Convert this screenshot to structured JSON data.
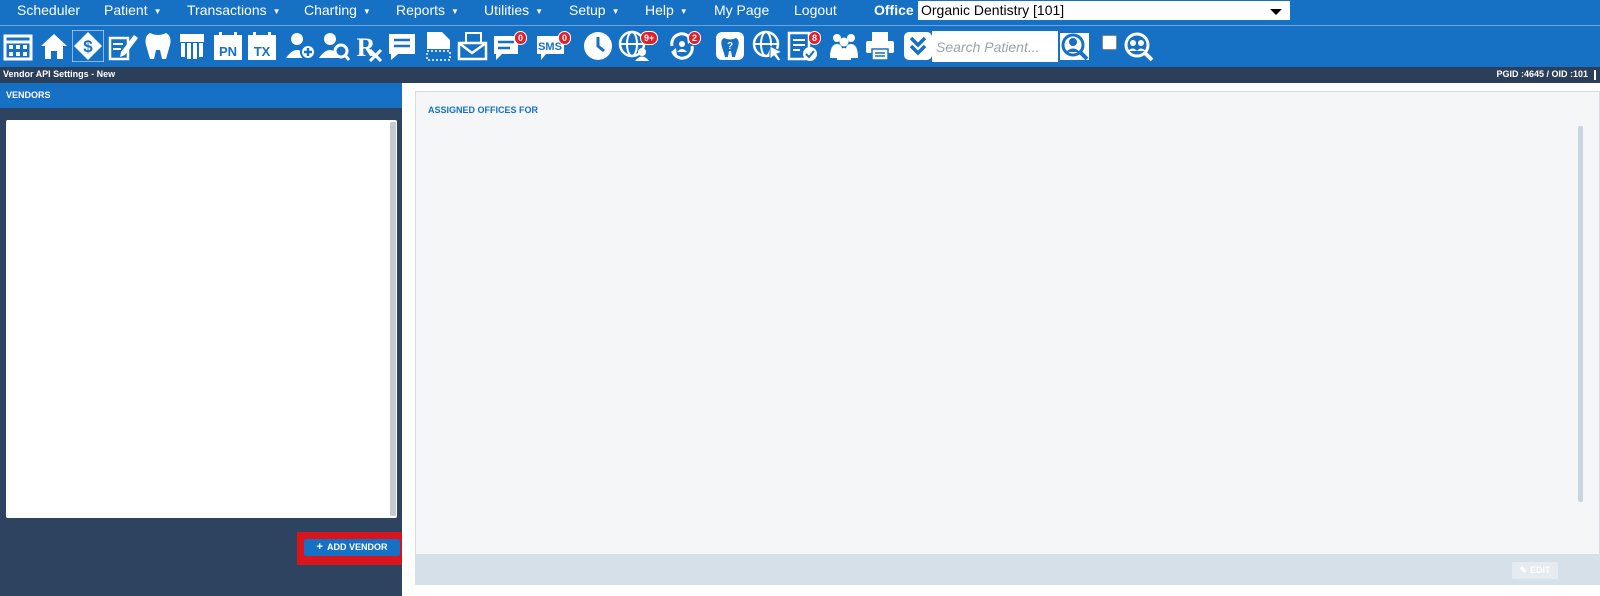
{
  "menu": {
    "items": [
      {
        "label": "Scheduler",
        "caret": false
      },
      {
        "label": "Patient",
        "caret": true
      },
      {
        "label": "Transactions",
        "caret": true
      },
      {
        "label": "Charting",
        "caret": true
      },
      {
        "label": "Reports",
        "caret": true
      },
      {
        "label": "Utilities",
        "caret": true
      },
      {
        "label": "Setup",
        "caret": true
      },
      {
        "label": "Help",
        "caret": true
      },
      {
        "label": "My Page",
        "caret": false
      },
      {
        "label": "Logout",
        "caret": false
      }
    ],
    "office_label": "Office",
    "office_value": "Organic Dentistry [101]"
  },
  "toolbar": {
    "icons": [
      {
        "name": "calendar-icon"
      },
      {
        "name": "home-icon"
      },
      {
        "name": "dollar-icon"
      },
      {
        "name": "edit-icon"
      },
      {
        "name": "tooth-icon"
      },
      {
        "name": "teeth-chart-icon"
      },
      {
        "name": "pn-calendar-icon",
        "text": "PN"
      },
      {
        "name": "tx-calendar-icon",
        "text": "TX"
      },
      {
        "name": "add-patient-icon"
      },
      {
        "name": "search-patient-icon"
      },
      {
        "name": "rx-icon",
        "text": "Rx"
      },
      {
        "name": "notes-icon"
      },
      {
        "name": "document-icon"
      },
      {
        "name": "mail-icon"
      },
      {
        "name": "chat-icon",
        "badge": "0"
      },
      {
        "name": "sms-icon",
        "text": "SMS",
        "badge": "0"
      },
      {
        "name": "clock-icon"
      },
      {
        "name": "globe-users-icon",
        "badge": "9+"
      },
      {
        "name": "sync-icon",
        "badge": "2"
      },
      {
        "name": "help-tooth-icon"
      },
      {
        "name": "web-cursor-icon"
      },
      {
        "name": "checklist-icon",
        "badge": "8"
      },
      {
        "name": "group-icon"
      },
      {
        "name": "print-icon"
      },
      {
        "name": "expand-down-icon"
      }
    ],
    "search_placeholder": "Search Patient..."
  },
  "status": {
    "title": "Vendor API Settings - New",
    "ids": "PGID :4645  /  OID :101"
  },
  "vendors": {
    "header": "VENDORS",
    "add_button": "ADD VENDOR"
  },
  "assigned": {
    "title": "ASSIGNED OFFICES FOR",
    "edit_button": "EDIT"
  },
  "colors": {
    "brand_blue": "#1670c4",
    "panel_dark": "#2d4360",
    "highlight_red": "#d8141c"
  }
}
